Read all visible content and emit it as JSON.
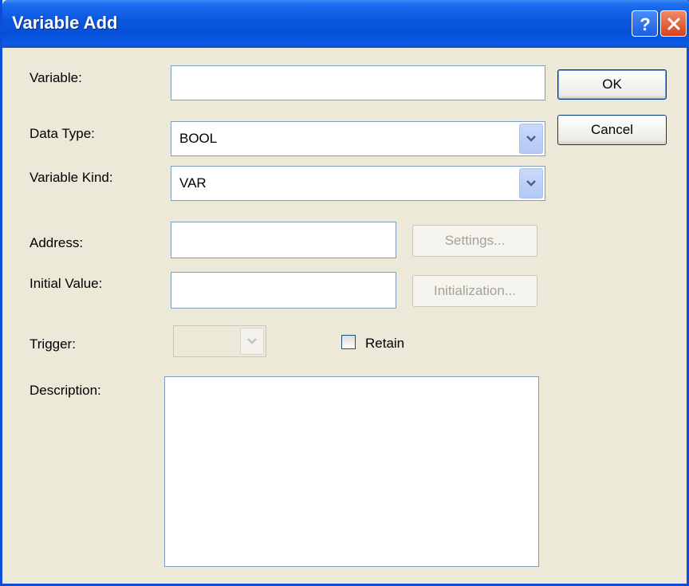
{
  "window": {
    "title": "Variable Add",
    "help_label": "?",
    "close_label": "close"
  },
  "fields": {
    "variable": {
      "label": "Variable:",
      "value": ""
    },
    "data_type": {
      "label": "Data Type:",
      "value": "BOOL"
    },
    "variable_kind": {
      "label": "Variable Kind:",
      "value": "VAR"
    },
    "address": {
      "label": "Address:",
      "value": ""
    },
    "initial_value": {
      "label": "Initial Value:",
      "value": ""
    },
    "trigger": {
      "label": "Trigger:",
      "value": ""
    },
    "retain": {
      "label": "Retain",
      "checked": false
    },
    "description": {
      "label": "Description:",
      "value": ""
    }
  },
  "buttons": {
    "ok": "OK",
    "cancel": "Cancel",
    "settings": "Settings...",
    "initialization": "Initialization..."
  },
  "colors": {
    "titlebar": "#0550d8",
    "dialog_bg": "#ece9d8",
    "input_border": "#7f9db9",
    "close_button": "#d8411b"
  },
  "icons": {
    "help": "help-icon",
    "close": "close-icon",
    "dropdown": "chevron-down-icon"
  }
}
